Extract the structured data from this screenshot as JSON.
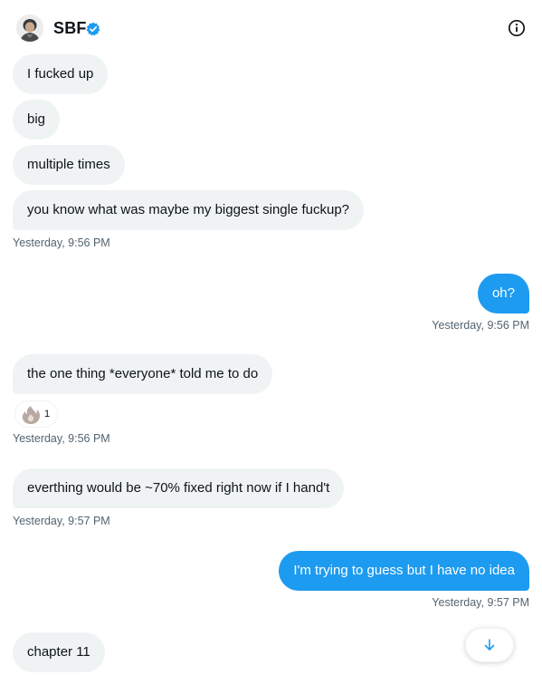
{
  "header": {
    "name": "SBF",
    "icons": {
      "avatar": "profile-avatar",
      "verified": "verified-badge-icon",
      "info": "info-icon"
    }
  },
  "messages": [
    {
      "text": "I fucked up",
      "side": "incoming"
    },
    {
      "text": "big",
      "side": "incoming"
    },
    {
      "text": "multiple times",
      "side": "incoming"
    },
    {
      "text": "you know what was maybe my biggest single fuckup?",
      "side": "incoming",
      "time": "Yesterday, 9:56 PM"
    },
    {
      "text": "oh?",
      "side": "outgoing",
      "time": "Yesterday, 9:56 PM"
    },
    {
      "text": "the one thing *everyone* told me to do",
      "side": "incoming",
      "reaction_count": "1",
      "time": "Yesterday, 9:56 PM"
    },
    {
      "text": "everthing would be ~70% fixed right now if I hand't",
      "side": "incoming",
      "time": "Yesterday, 9:57 PM"
    },
    {
      "text": "I'm trying to guess but I have no idea",
      "side": "outgoing",
      "time": "Yesterday, 9:57 PM"
    },
    {
      "text": "chapter 11",
      "side": "incoming"
    }
  ],
  "reaction_icon": "fire-emoji",
  "scroll_button_icon": "arrow-down-icon",
  "colors": {
    "outgoing_bubble": "#1d9bf0",
    "incoming_bubble": "#eff3f4",
    "verified": "#1d9bf0",
    "timestamp": "#536471"
  }
}
